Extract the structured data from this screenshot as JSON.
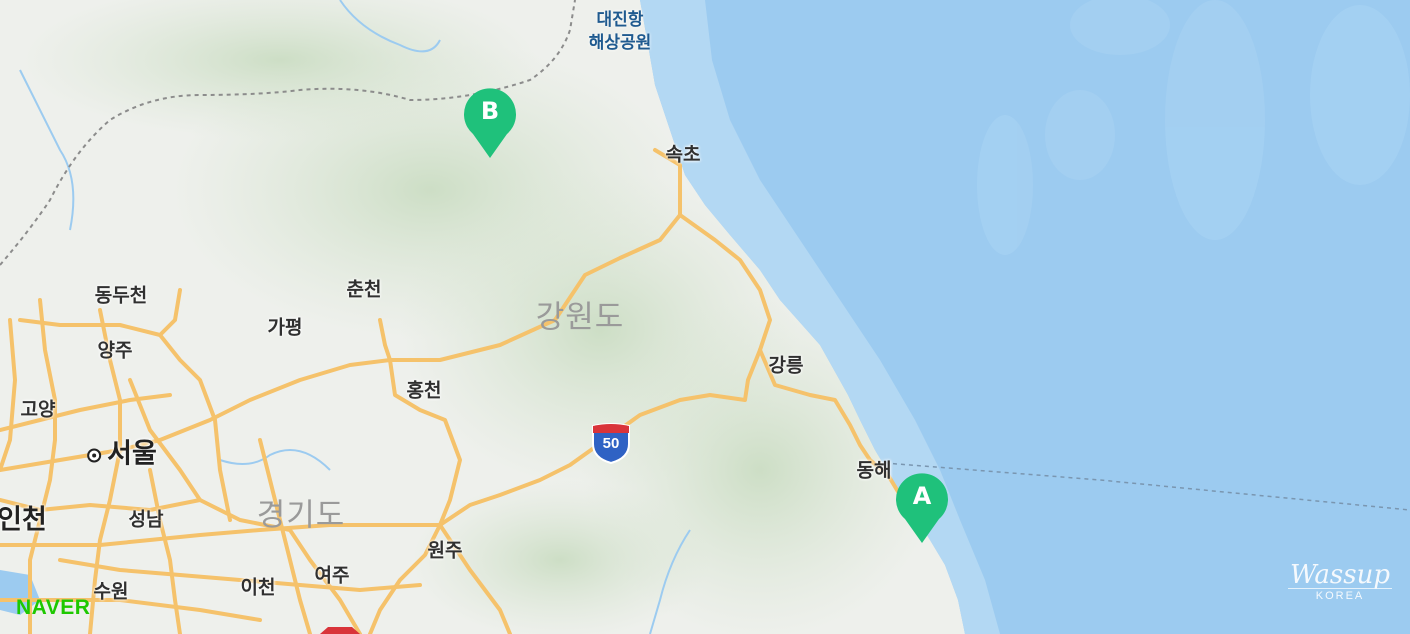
{
  "map": {
    "region_labels": {
      "gangwon": "강원도",
      "gyeonggi": "경기도"
    },
    "city_labels": {
      "sokcho": "속초",
      "chuncheon": "춘천",
      "dongducheon": "동두천",
      "gapyeong": "가평",
      "yangju": "양주",
      "gangneung": "강릉",
      "hongcheon": "홍천",
      "goyang": "고양",
      "seoul": "서울",
      "donghae": "동해",
      "incheon": "인천",
      "seongnam": "성남",
      "wonju": "원주",
      "yeoju": "여주",
      "suwon": "수원",
      "icheon": "이천"
    },
    "park_label": {
      "line1": "대진항",
      "line2": "해상공원"
    },
    "markers": {
      "a": "A",
      "b": "B"
    },
    "highway_shield": "50",
    "logo": "NAVER",
    "watermark": {
      "line1": "Wassup",
      "line2": "KOREA"
    },
    "colors": {
      "sea": "#9ccbf0",
      "land": "#eef0ec",
      "road": "#f5c26b",
      "marker": "#1fc17b"
    }
  }
}
